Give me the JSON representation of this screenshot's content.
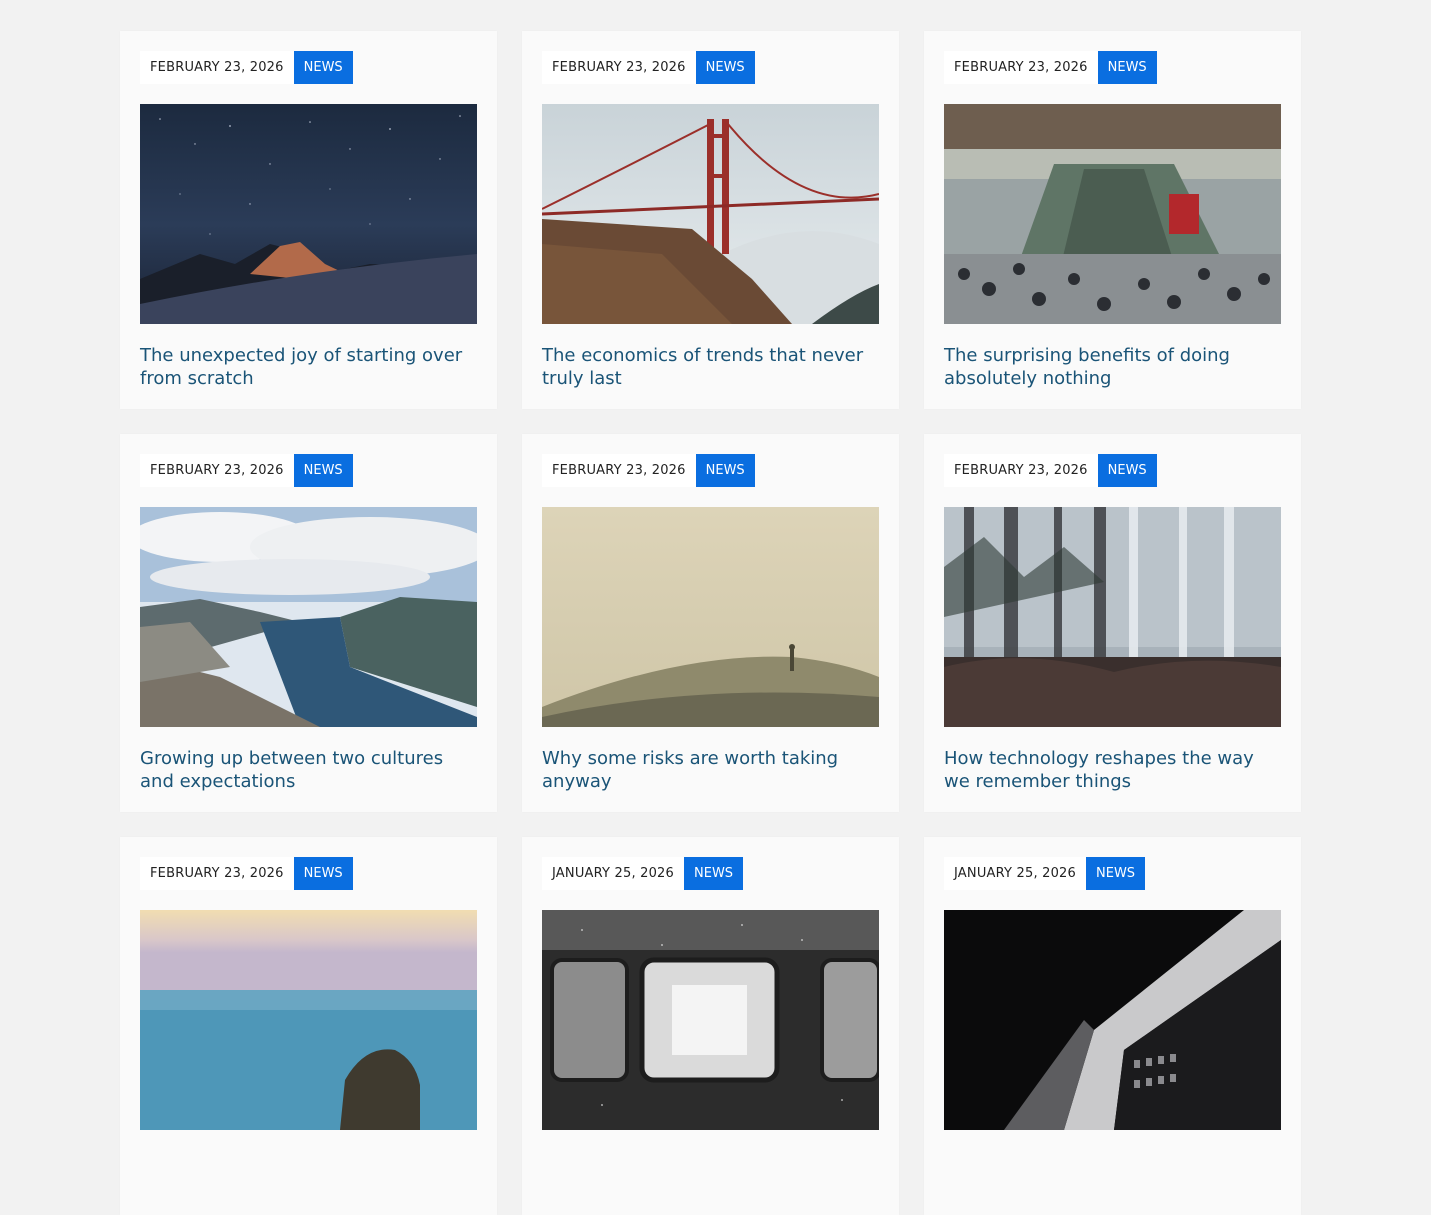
{
  "posts": [
    {
      "date": "FEBRUARY 23, 2026",
      "category": "NEWS",
      "title": "The unexpected joy of starting over from scratch",
      "image": "night-sky-mountain"
    },
    {
      "date": "FEBRUARY 23, 2026",
      "category": "NEWS",
      "title": "The economics of trends that never truly last",
      "image": "golden-gate-bridge-fog"
    },
    {
      "date": "FEBRUARY 23, 2026",
      "category": "NEWS",
      "title": "The surprising benefits of doing absolutely nothing",
      "image": "crowded-station"
    },
    {
      "date": "FEBRUARY 23, 2026",
      "category": "NEWS",
      "title": "Growing up between two cultures and expectations",
      "image": "fjord-landscape"
    },
    {
      "date": "FEBRUARY 23, 2026",
      "category": "NEWS",
      "title": "Why some risks are worth taking anyway",
      "image": "foggy-hill-person"
    },
    {
      "date": "FEBRUARY 23, 2026",
      "category": "NEWS",
      "title": "How technology reshapes the way we remember things",
      "image": "misty-forest"
    },
    {
      "date": "FEBRUARY 23, 2026",
      "category": "NEWS",
      "title": "",
      "image": "sea-rock-sunset"
    },
    {
      "date": "JANUARY 25, 2026",
      "category": "NEWS",
      "title": "",
      "image": "train-window-bw"
    },
    {
      "date": "JANUARY 25, 2026",
      "category": "NEWS",
      "title": "",
      "image": "building-bw"
    }
  ],
  "colors": {
    "accent": "#0a6ee0",
    "title": "#1a5477",
    "background": "#f2f2f2",
    "card": "#fafafa"
  }
}
